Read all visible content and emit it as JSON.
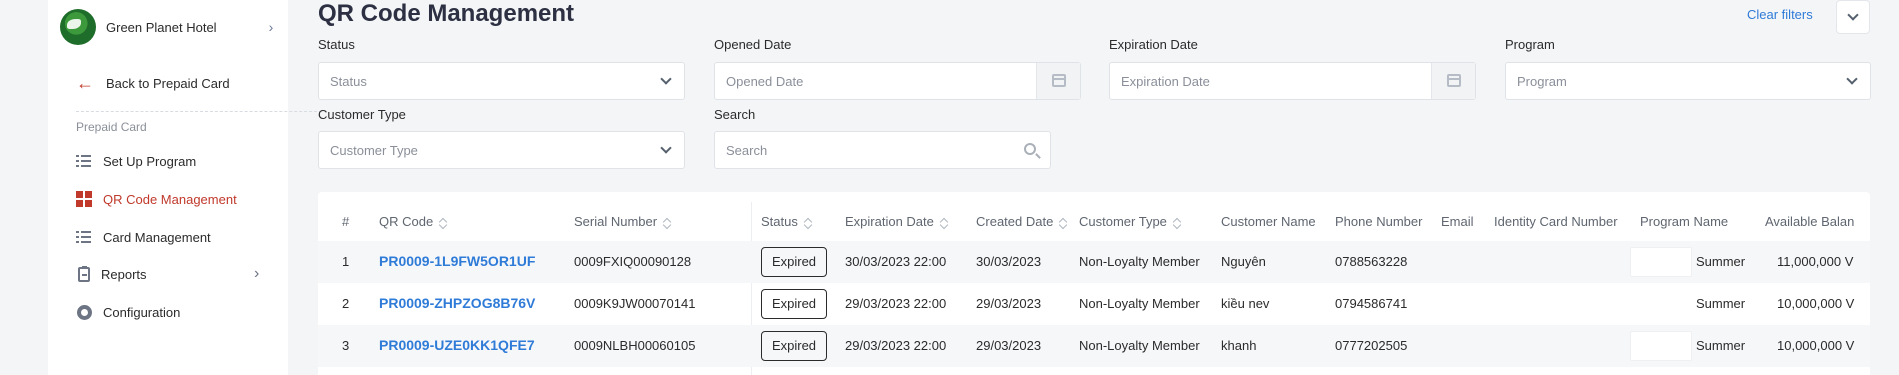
{
  "sidebar": {
    "hotel_name": "Green Planet Hotel",
    "back_label": "Back to Prepaid Card",
    "section_title": "Prepaid Card",
    "items": [
      {
        "label": "Set Up Program",
        "icon": "list-icon"
      },
      {
        "label": "QR Code Management",
        "icon": "grid-icon",
        "active": true
      },
      {
        "label": "Card Management",
        "icon": "list-icon"
      },
      {
        "label": "Reports",
        "icon": "clipboard-icon"
      },
      {
        "label": "Configuration",
        "icon": "gear-icon"
      }
    ]
  },
  "header": {
    "title": "QR Code Management",
    "clear_filters": "Clear filters"
  },
  "filters": {
    "status": {
      "label": "Status",
      "placeholder": "Status"
    },
    "opened_date": {
      "label": "Opened Date",
      "placeholder": "Opened Date"
    },
    "expiration_date": {
      "label": "Expiration Date",
      "placeholder": "Expiration Date"
    },
    "program": {
      "label": "Program",
      "placeholder": "Program"
    },
    "customer_type": {
      "label": "Customer Type",
      "placeholder": "Customer Type"
    },
    "search": {
      "label": "Search",
      "placeholder": "Search"
    }
  },
  "table": {
    "columns": [
      "#",
      "QR Code",
      "Serial Number",
      "Status",
      "Expiration Date",
      "Created Date",
      "Customer Type",
      "Customer Name",
      "Phone Number",
      "Email",
      "Identity Card Number",
      "Program Name",
      "Available Balan"
    ],
    "rows": [
      {
        "index": "1",
        "qr_code": "PR0009-1L9FW5OR1UF",
        "serial": "0009FXIQ00090128",
        "status": "Expired",
        "expiration": "30/03/2023 22:00",
        "created": "30/03/2023",
        "customer_type": "Non-Loyalty Member",
        "customer_name": "Nguyên",
        "phone": "0788563228",
        "email": "",
        "identity": "",
        "program": "Summer",
        "balance": "11,000,000 V"
      },
      {
        "index": "2",
        "qr_code": "PR0009-ZHPZOG8B76V",
        "serial": "0009K9JW00070141",
        "status": "Expired",
        "expiration": "29/03/2023 22:00",
        "created": "29/03/2023",
        "customer_type": "Non-Loyalty Member",
        "customer_name": "kiều nev",
        "phone": "0794586741",
        "email": "",
        "identity": "",
        "program": "Summer",
        "balance": "10,000,000 V"
      },
      {
        "index": "3",
        "qr_code": "PR0009-UZE0KK1QFE7",
        "serial": "0009NLBH00060105",
        "status": "Expired",
        "expiration": "29/03/2023 22:00",
        "created": "29/03/2023",
        "customer_type": "Non-Loyalty Member",
        "customer_name": "khanh",
        "phone": "0777202505",
        "email": "",
        "identity": "",
        "program": "Summer",
        "balance": "10,000,000 V"
      }
    ]
  },
  "colors": {
    "accent": "#c0392b",
    "link": "#2f7bd8"
  }
}
